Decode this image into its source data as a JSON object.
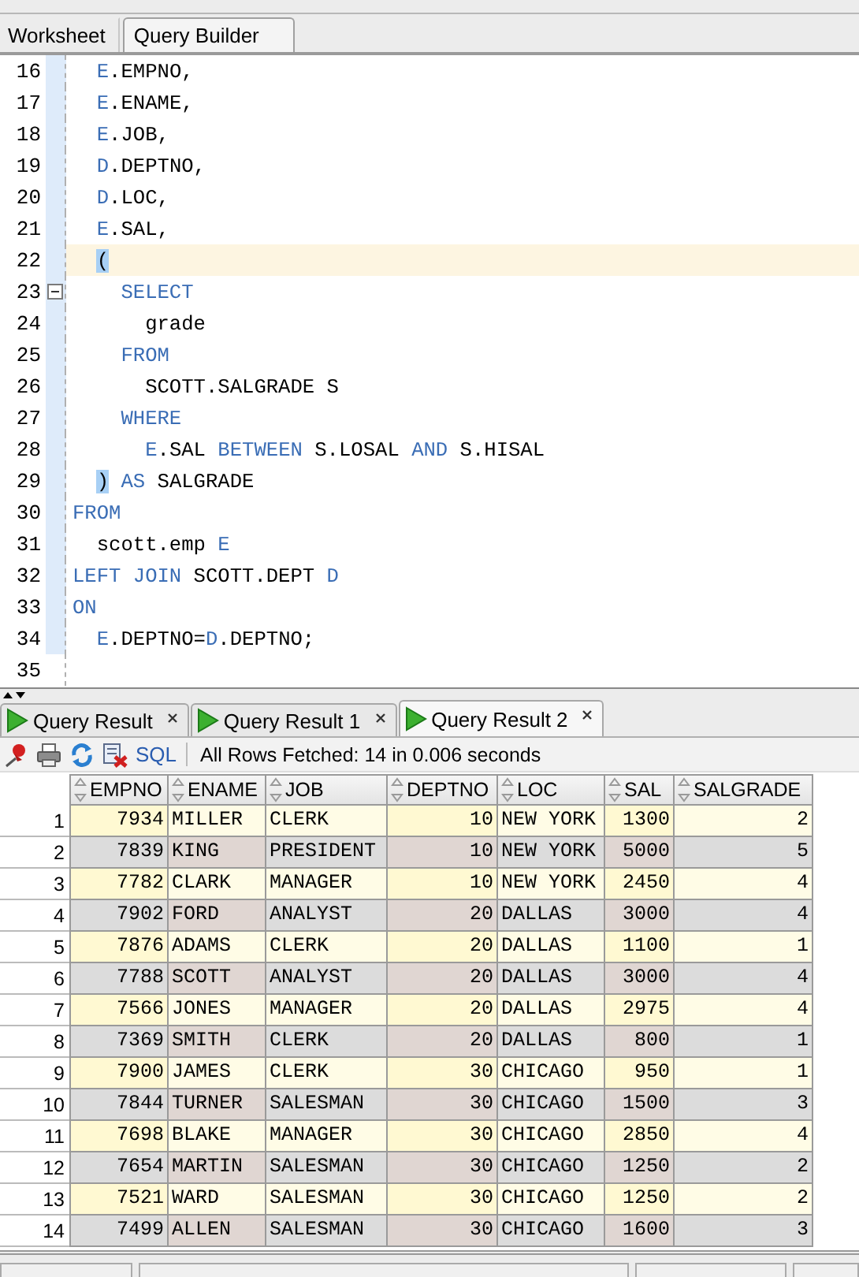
{
  "editor_tabs": [
    {
      "label": "Worksheet",
      "selected": true
    },
    {
      "label": "Query Builder",
      "selected": false
    }
  ],
  "editor": {
    "lines": [
      {
        "number": "16",
        "current": false,
        "fold": false,
        "tokens": [
          {
            "kind": "keyword",
            "text": "  E"
          },
          {
            "kind": "plain",
            "text": ".EMPNO,"
          }
        ]
      },
      {
        "number": "17",
        "current": false,
        "fold": false,
        "tokens": [
          {
            "kind": "keyword",
            "text": "  E"
          },
          {
            "kind": "plain",
            "text": ".ENAME,"
          }
        ]
      },
      {
        "number": "18",
        "current": false,
        "fold": false,
        "tokens": [
          {
            "kind": "keyword",
            "text": "  E"
          },
          {
            "kind": "plain",
            "text": ".JOB,"
          }
        ]
      },
      {
        "number": "19",
        "current": false,
        "fold": false,
        "tokens": [
          {
            "kind": "keyword",
            "text": "  D"
          },
          {
            "kind": "plain",
            "text": ".DEPTNO,"
          }
        ]
      },
      {
        "number": "20",
        "current": false,
        "fold": false,
        "tokens": [
          {
            "kind": "keyword",
            "text": "  D"
          },
          {
            "kind": "plain",
            "text": ".LOC,"
          }
        ]
      },
      {
        "number": "21",
        "current": false,
        "fold": false,
        "tokens": [
          {
            "kind": "keyword",
            "text": "  E"
          },
          {
            "kind": "plain",
            "text": ".SAL,"
          }
        ]
      },
      {
        "number": "22",
        "current": true,
        "fold": false,
        "tokens": [
          {
            "kind": "bracket",
            "text": "  ("
          }
        ]
      },
      {
        "number": "23",
        "current": false,
        "fold": true,
        "tokens": [
          {
            "kind": "keyword",
            "text": "    SELECT"
          }
        ]
      },
      {
        "number": "24",
        "current": false,
        "fold": false,
        "tokens": [
          {
            "kind": "plain",
            "text": "      grade"
          }
        ]
      },
      {
        "number": "25",
        "current": false,
        "fold": false,
        "tokens": [
          {
            "kind": "keyword",
            "text": "    FROM"
          }
        ]
      },
      {
        "number": "26",
        "current": false,
        "fold": false,
        "tokens": [
          {
            "kind": "plain",
            "text": "      SCOTT.SALGRADE S"
          }
        ]
      },
      {
        "number": "27",
        "current": false,
        "fold": false,
        "tokens": [
          {
            "kind": "keyword",
            "text": "    WHERE"
          }
        ]
      },
      {
        "number": "28",
        "current": false,
        "fold": false,
        "tokens": [
          {
            "kind": "keyword",
            "text": "      E"
          },
          {
            "kind": "plain",
            "text": ".SAL "
          },
          {
            "kind": "keyword",
            "text": "BETWEEN"
          },
          {
            "kind": "plain",
            "text": " S.LOSAL "
          },
          {
            "kind": "keyword",
            "text": "AND"
          },
          {
            "kind": "plain",
            "text": " S.HISAL"
          }
        ]
      },
      {
        "number": "29",
        "current": false,
        "fold": false,
        "tokens": [
          {
            "kind": "bracket",
            "text": "  )"
          },
          {
            "kind": "keyword",
            "text": " AS"
          },
          {
            "kind": "plain",
            "text": " SALGRADE"
          }
        ]
      },
      {
        "number": "30",
        "current": false,
        "fold": false,
        "tokens": [
          {
            "kind": "keyword",
            "text": "FROM"
          }
        ]
      },
      {
        "number": "31",
        "current": false,
        "fold": false,
        "tokens": [
          {
            "kind": "plain",
            "text": "  scott.emp "
          },
          {
            "kind": "keyword",
            "text": "E"
          }
        ]
      },
      {
        "number": "32",
        "current": false,
        "fold": false,
        "tokens": [
          {
            "kind": "keyword",
            "text": "LEFT JOIN"
          },
          {
            "kind": "plain",
            "text": " SCOTT.DEPT "
          },
          {
            "kind": "keyword",
            "text": "D"
          }
        ]
      },
      {
        "number": "33",
        "current": false,
        "fold": false,
        "tokens": [
          {
            "kind": "keyword",
            "text": "ON"
          }
        ]
      },
      {
        "number": "34",
        "current": false,
        "fold": false,
        "tokens": [
          {
            "kind": "keyword",
            "text": "  E"
          },
          {
            "kind": "plain",
            "text": ".DEPTNO="
          },
          {
            "kind": "keyword",
            "text": "D"
          },
          {
            "kind": "plain",
            "text": ".DEPTNO;"
          }
        ]
      },
      {
        "number": "35",
        "current": false,
        "fold": false
      }
    ]
  },
  "result_tabs": [
    {
      "label": "Query Result",
      "selected": false
    },
    {
      "label": "Query Result 1",
      "selected": false
    },
    {
      "label": "Query Result 2",
      "selected": true
    }
  ],
  "result_toolbar": {
    "sql_link": "SQL",
    "status": "All Rows Fetched: 14 in 0.006 seconds"
  },
  "table": {
    "columns": [
      {
        "label": "EMPNO",
        "kind": "number"
      },
      {
        "label": "ENAME",
        "kind": "text"
      },
      {
        "label": "JOB",
        "kind": "text"
      },
      {
        "label": "DEPTNO",
        "kind": "number"
      },
      {
        "label": "LOC",
        "kind": "text"
      },
      {
        "label": "SAL",
        "kind": "number"
      },
      {
        "label": "SALGRADE",
        "kind": "number"
      }
    ],
    "rows": [
      {
        "number": "1",
        "cells": [
          "7934",
          "MILLER",
          "CLERK",
          "10",
          "NEW YORK",
          "1300",
          "2"
        ]
      },
      {
        "number": "2",
        "cells": [
          "7839",
          "KING",
          "PRESIDENT",
          "10",
          "NEW YORK",
          "5000",
          "5"
        ]
      },
      {
        "number": "3",
        "cells": [
          "7782",
          "CLARK",
          "MANAGER",
          "10",
          "NEW YORK",
          "2450",
          "4"
        ]
      },
      {
        "number": "4",
        "cells": [
          "7902",
          "FORD",
          "ANALYST",
          "20",
          "DALLAS",
          "3000",
          "4"
        ]
      },
      {
        "number": "5",
        "cells": [
          "7876",
          "ADAMS",
          "CLERK",
          "20",
          "DALLAS",
          "1100",
          "1"
        ]
      },
      {
        "number": "6",
        "cells": [
          "7788",
          "SCOTT",
          "ANALYST",
          "20",
          "DALLAS",
          "3000",
          "4"
        ]
      },
      {
        "number": "7",
        "cells": [
          "7566",
          "JONES",
          "MANAGER",
          "20",
          "DALLAS",
          "2975",
          "4"
        ]
      },
      {
        "number": "8",
        "cells": [
          "7369",
          "SMITH",
          "CLERK",
          "20",
          "DALLAS",
          "800",
          "1"
        ]
      },
      {
        "number": "9",
        "cells": [
          "7900",
          "JAMES",
          "CLERK",
          "30",
          "CHICAGO",
          "950",
          "1"
        ]
      },
      {
        "number": "10",
        "cells": [
          "7844",
          "TURNER",
          "SALESMAN",
          "30",
          "CHICAGO",
          "1500",
          "3"
        ]
      },
      {
        "number": "11",
        "cells": [
          "7698",
          "BLAKE",
          "MANAGER",
          "30",
          "CHICAGO",
          "2850",
          "4"
        ]
      },
      {
        "number": "12",
        "cells": [
          "7654",
          "MARTIN",
          "SALESMAN",
          "30",
          "CHICAGO",
          "1250",
          "2"
        ]
      },
      {
        "number": "13",
        "cells": [
          "7521",
          "WARD",
          "SALESMAN",
          "30",
          "CHICAGO",
          "1250",
          "2"
        ]
      },
      {
        "number": "14",
        "cells": [
          "7499",
          "ALLEN",
          "SALESMAN",
          "30",
          "CHICAGO",
          "1600",
          "3"
        ]
      }
    ]
  }
}
